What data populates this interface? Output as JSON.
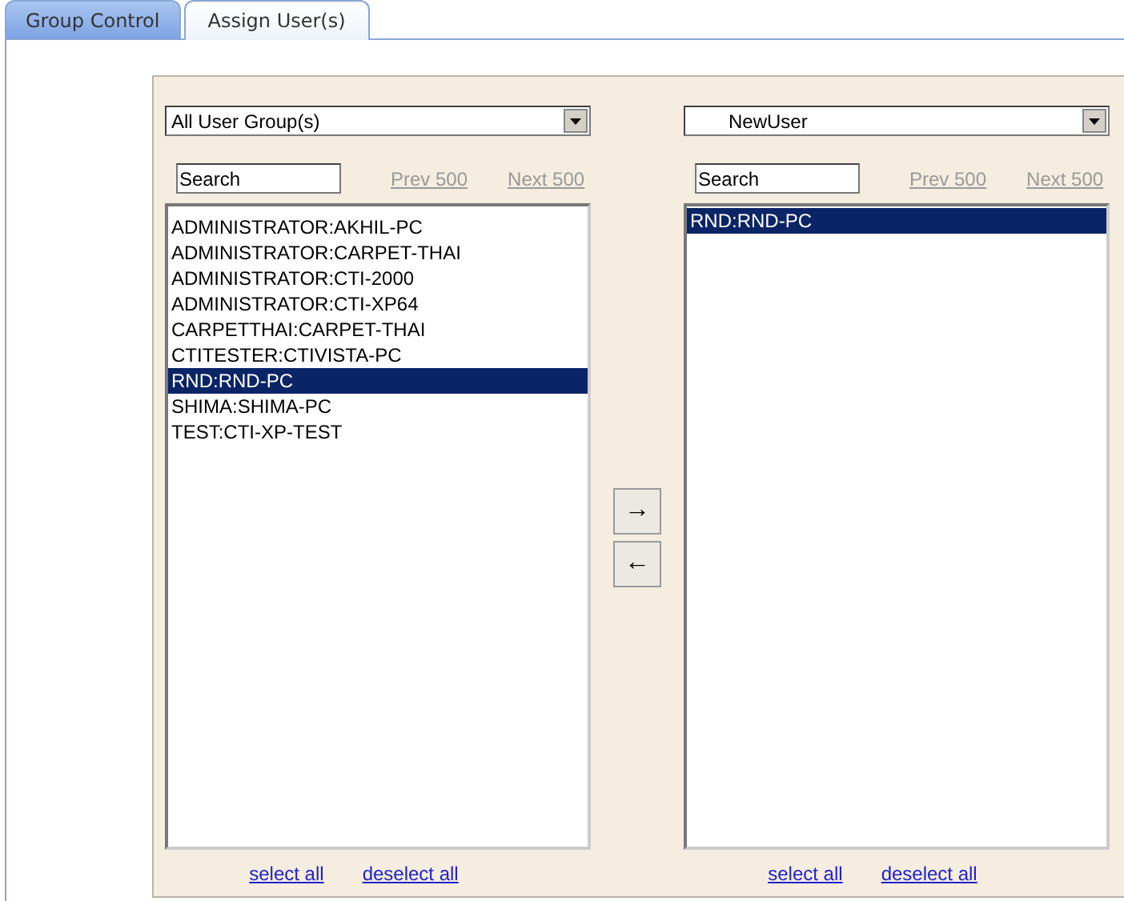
{
  "tabs": [
    {
      "label": "Group Control",
      "selected": false
    },
    {
      "label": "Assign User(s)",
      "selected": true
    }
  ],
  "left": {
    "dropdown": "All User Group(s)",
    "search": "Search",
    "prev": "Prev 500",
    "next": "Next 500",
    "items": [
      {
        "label": "ADMINISTRATOR:AKHIL-PC",
        "selected": false
      },
      {
        "label": "ADMINISTRATOR:CARPET-THAI",
        "selected": false
      },
      {
        "label": "ADMINISTRATOR:CTI-2000",
        "selected": false
      },
      {
        "label": "ADMINISTRATOR:CTI-XP64",
        "selected": false
      },
      {
        "label": "CARPETTHAI:CARPET-THAI",
        "selected": false
      },
      {
        "label": "CTITESTER:CTIVISTA-PC",
        "selected": false
      },
      {
        "label": "RND:RND-PC",
        "selected": true
      },
      {
        "label": "SHIMA:SHIMA-PC",
        "selected": false
      },
      {
        "label": "TEST:CTI-XP-TEST",
        "selected": false
      }
    ],
    "select_all": "select all",
    "deselect_all": "deselect all"
  },
  "move_buttons": [
    "→",
    "←"
  ],
  "right": {
    "dropdown": "NewUser",
    "search": "Search",
    "prev": "Prev 500",
    "next": "Next 500",
    "items": [
      {
        "label": "RND:RND-PC",
        "selected": true
      }
    ],
    "select_all": "select all",
    "deselect_all": "deselect all"
  }
}
